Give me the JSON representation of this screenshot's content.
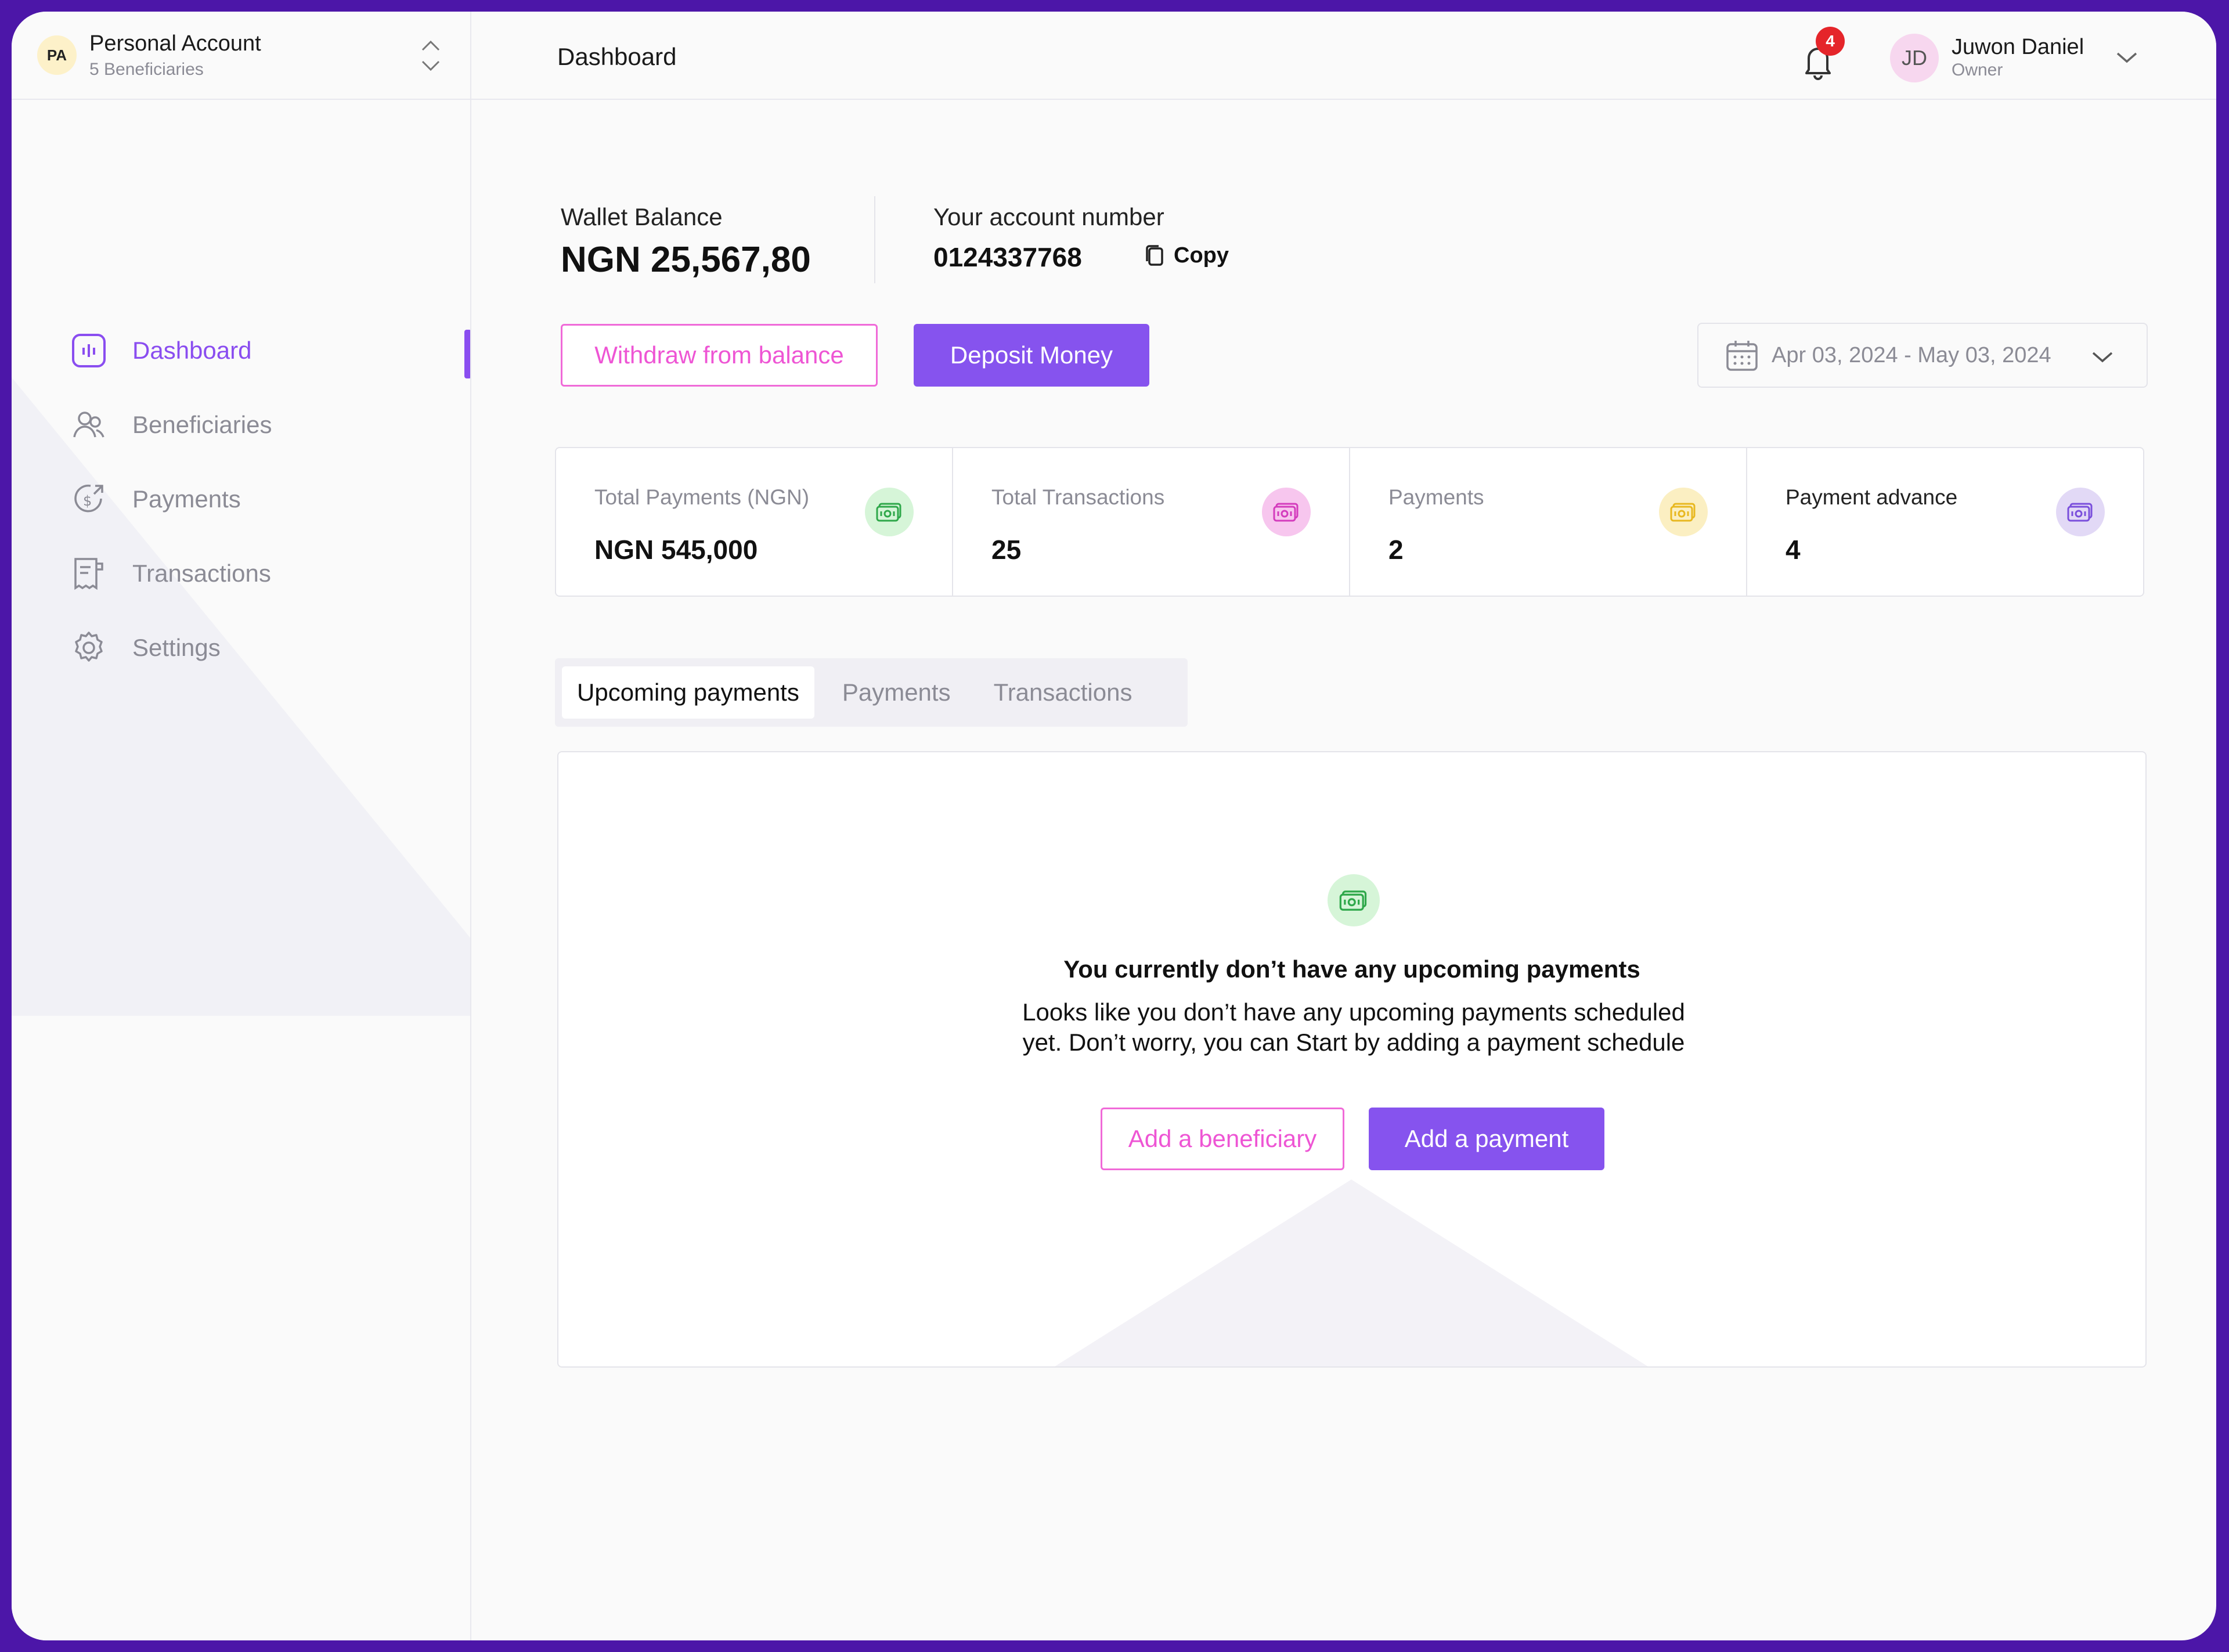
{
  "account": {
    "initials": "PA",
    "name": "Personal Account",
    "sub": "5 Beneficiaries"
  },
  "sidebar": {
    "items": [
      {
        "label": "Dashboard",
        "icon": "dashboard-icon",
        "active": true
      },
      {
        "label": "Beneficiaries",
        "icon": "users-icon"
      },
      {
        "label": "Payments",
        "icon": "dollar-circle-icon"
      },
      {
        "label": "Transactions",
        "icon": "receipt-icon"
      },
      {
        "label": "Settings",
        "icon": "gear-icon"
      }
    ]
  },
  "header": {
    "title": "Dashboard",
    "notifications": "4",
    "user_initials": "JD",
    "user_name": "Juwon Daniel",
    "user_role": "Owner"
  },
  "wallet": {
    "label": "Wallet Balance",
    "value": "NGN 25,567,80"
  },
  "account_number": {
    "label": "Your account number",
    "value": "0124337768",
    "copy_label": "Copy"
  },
  "actions": {
    "withdraw": "Withdraw from balance",
    "deposit": "Deposit Money"
  },
  "date_range": "Apr 03, 2024 - May 03, 2024",
  "stats": [
    {
      "label": "Total Payments (NGN)",
      "value": "NGN 545,000",
      "color": "#d6f5d8"
    },
    {
      "label": "Total Transactions",
      "value": "25",
      "color": "#f7c6ee"
    },
    {
      "label": "Payments",
      "value": "2",
      "color": "#fbefc2"
    },
    {
      "label": "Payment advance",
      "value": "4",
      "color": "#e2d9f6"
    }
  ],
  "tabs": [
    "Upcoming payments",
    "Payments",
    "Transactions"
  ],
  "empty": {
    "title": "You currently don’t have any upcoming payments",
    "body_line1": "Looks like you don’t have any upcoming payments scheduled",
    "body_line2": "yet. Don’t worry, you can Start by adding a payment schedule",
    "add_beneficiary": "Add a beneficiary",
    "add_payment": "Add a payment"
  },
  "colors": {
    "accent": "#8653ee",
    "pink": "#ee55d4",
    "frame": "#4c16a8"
  }
}
